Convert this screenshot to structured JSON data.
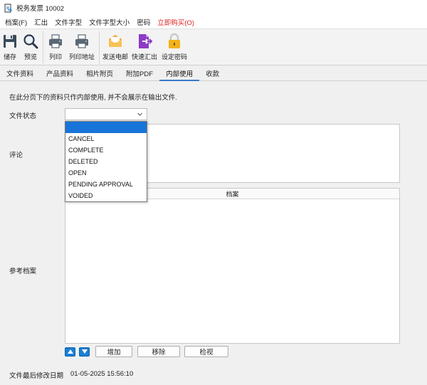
{
  "window": {
    "title": "税务发票 10002"
  },
  "menu": [
    {
      "label": "档案(F)"
    },
    {
      "label": "汇出"
    },
    {
      "label": "文件字型"
    },
    {
      "label": "文件字型大小"
    },
    {
      "label": "密码"
    },
    {
      "label": "立即购买(O)",
      "accent": "#e02020"
    }
  ],
  "toolbar": {
    "save": "储存",
    "preview": "预览",
    "print": "列印",
    "print_address": "列印地址",
    "send_email": "发送电邮",
    "quick_export": "快速汇出",
    "set_password": "设定密码"
  },
  "tabs": [
    {
      "label": "文件资料",
      "active": false
    },
    {
      "label": "产品资料",
      "active": false
    },
    {
      "label": "相片附页",
      "active": false
    },
    {
      "label": "附加PDF",
      "active": false
    },
    {
      "label": "内部使用",
      "active": true
    },
    {
      "label": "收款",
      "active": false
    }
  ],
  "content": {
    "note": "在此分页下的资料只作内部使用, 并不会展示在输出文件.",
    "status_label": "文件状态",
    "comment_label": "评论",
    "reference_label": "参考档案",
    "reference_column": "档案",
    "add_button": "增加",
    "remove_button": "移除",
    "view_button": "检视",
    "modified_label": "文件最后修改日期",
    "modified_value": "01-05-2025 15:56:10"
  },
  "status_dropdown": {
    "selected": "",
    "options": [
      "",
      "CANCEL",
      "COMPLETE",
      "DELETED",
      "OPEN",
      "PENDING APPROVAL",
      "VOIDED"
    ]
  },
  "colors": {
    "accent": "#1874d8",
    "tab_underline": "#3a78c9",
    "buy_text": "#e02020",
    "arrow_button": "#1a7fd6"
  }
}
